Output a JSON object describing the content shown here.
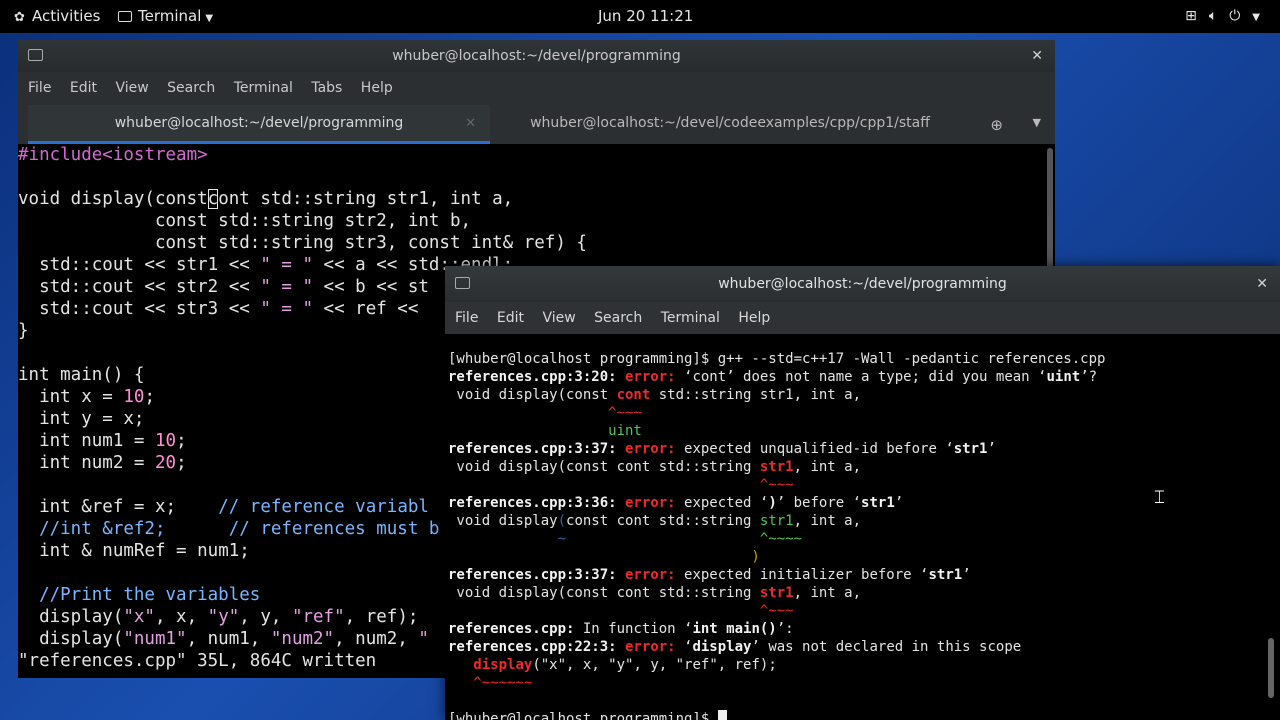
{
  "topbar": {
    "activities": "Activities",
    "app_menu": "Terminal",
    "clock": "Jun 20  11:21"
  },
  "back_window": {
    "title": "whuber@localhost:~/devel/programming",
    "menu": [
      "File",
      "Edit",
      "View",
      "Search",
      "Terminal",
      "Tabs",
      "Help"
    ],
    "tabs": [
      {
        "label": "whuber@localhost:~/devel/programming",
        "active": true
      },
      {
        "label": "whuber@localhost:~/devel/codeexamples/cpp/cpp1/staff",
        "active": false
      }
    ],
    "code": {
      "l1_inc": "#include",
      "l1_hdr": "<iostream>",
      "l3_a": "void display(const",
      "l3_b": "c",
      "l3_c": "ont std::string str1, ",
      "l3_int": "int",
      "l3_d": " a,",
      "l4": "             const std::string str2, ",
      "l4_int": "int",
      "l4_b": " b,",
      "l5": "             const std::string str3, const ",
      "l5_int": "int",
      "l5_b": "& ref) {",
      "l6": "  std::cout << str1 << ",
      "l6_s": "\" = \"",
      "l6_b": " << a << std::endl;",
      "l7": "  std::cout << str2 << ",
      "l7_s": "\" = \"",
      "l7_b": " << b << st",
      "l8": "  std::cout << str3 << ",
      "l8_s": "\" = \"",
      "l8_b": " << ref << ",
      "l9": "}",
      "l11_int": "int",
      "l11": " main() {",
      "l12_int": "  int",
      "l12": " x = ",
      "l12_n": "10",
      "l12_e": ";",
      "l13_int": "  int",
      "l13": " y = x;",
      "l14_int": "  int",
      "l14": " num1 = ",
      "l14_n": "10",
      "l14_e": ";",
      "l15_int": "  int",
      "l15": " num2 = ",
      "l15_n": "20",
      "l15_e": ";",
      "l17_int": "  int",
      "l17": " &ref = x;    ",
      "l17_c": "// reference variabl",
      "l18_c": "  //int &ref2;      // references must b",
      "l19_int": "  int",
      "l19": " & numRef = num1;",
      "l21_c": "  //Print the variables",
      "l22": "  display(",
      "l22_s1": "\"x\"",
      "l22_b": ", x, ",
      "l22_s2": "\"y\"",
      "l22_c": ", y, ",
      "l22_s3": "\"ref\"",
      "l22_d": ", ref);",
      "l23": "  display(",
      "l23_s1": "\"num1\"",
      "l23_b": ", num1, ",
      "l23_s2": "\"num2\"",
      "l23_c": ", num2, ",
      "l23_s3": "\"",
      "status": "\"references.cpp\" 35L, 864C written"
    }
  },
  "front_window": {
    "title": "whuber@localhost:~/devel/programming",
    "menu": [
      "File",
      "Edit",
      "View",
      "Search",
      "Terminal",
      "Help"
    ],
    "out": {
      "cmd": "[whuber@localhost programming]$ g++ --std=c++17 -Wall -pedantic references.cpp",
      "e1_loc": "references.cpp:3:20:",
      "e1_err": "error:",
      "e1_a": " ‘cont’ does not name a type; did you mean ‘",
      "e1_b": "uint",
      "e1_c": "’?",
      "e1_src_a": " void display(const ",
      "e1_src_b": "cont",
      "e1_src_c": " std::string str1, int a,",
      "e1_caret": "                   ^~~~",
      "e1_fix": "                   uint",
      "e2_loc": "references.cpp:3:37:",
      "e2_err": "error:",
      "e2_a": " expected unqualified-id before ‘",
      "e2_b": "str1",
      "e2_c": "’",
      "e2_src_a": " void display(const cont std::string ",
      "e2_src_b": "str1",
      "e2_src_c": ", int a,",
      "e2_caret": "                                     ^~~~",
      "e3_loc": "references.cpp:3:36:",
      "e3_err": "error:",
      "e3_a": " expected ‘",
      "e3_b": ")",
      "e3_c": "’ before ‘",
      "e3_d": "str1",
      "e3_e": "’",
      "e3_src_a": " void display",
      "e3_src_b": "(",
      "e3_src_c": "const cont std::string ",
      "e3_src_d": "str1",
      "e3_src_e": ", int a,",
      "e3_mark_a": "             ~",
      "e3_mark_b": "                       ^~~~~",
      "e3_fix": "                                    )",
      "e4_loc": "references.cpp:3:37:",
      "e4_err": "error:",
      "e4_a": " expected initializer before ‘",
      "e4_b": "str1",
      "e4_c": "’",
      "e4_src_a": " void display(const cont std::string ",
      "e4_src_b": "str1",
      "e4_src_c": ", int a,",
      "e4_caret": "                                     ^~~~",
      "e5_loc": "references.cpp:",
      "e5_a": " In function ‘",
      "e5_b": "int main()",
      "e5_c": "’:",
      "e6_loc": "references.cpp:22:3:",
      "e6_err": "error:",
      "e6_a": " ‘",
      "e6_b": "display",
      "e6_c": "’ was not declared in this scope",
      "e6_src_a": "   ",
      "e6_src_b": "display",
      "e6_src_c": "(\"x\", x, \"y\", y, \"ref\", ref);",
      "e6_caret": "   ^~~~~~~",
      "prompt": "[whuber@localhost programming]$ "
    }
  }
}
